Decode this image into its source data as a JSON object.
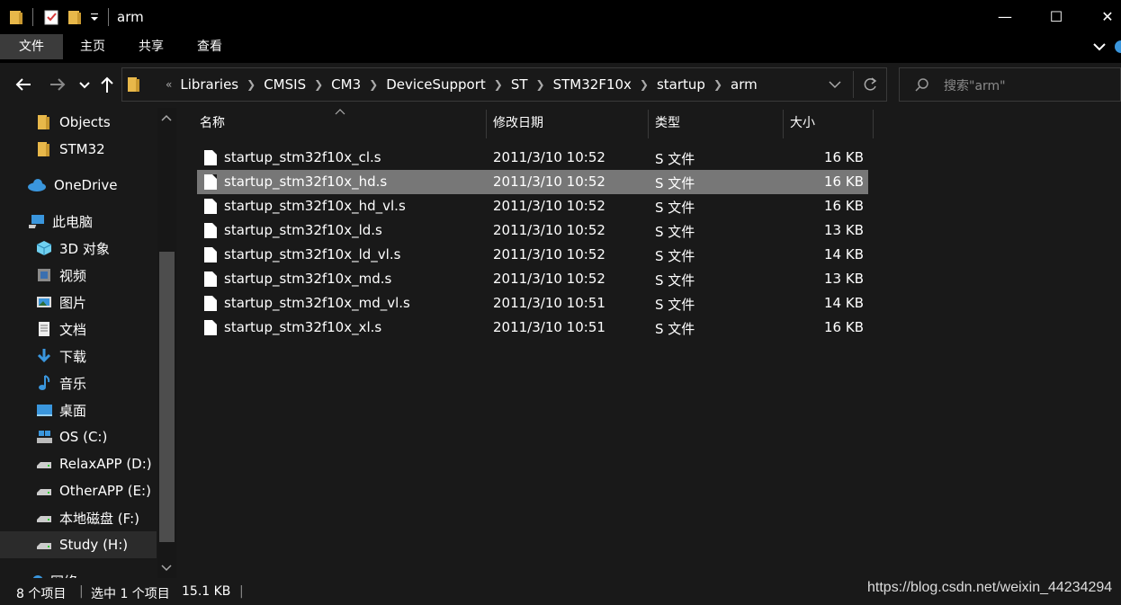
{
  "window": {
    "title": "arm",
    "minimize": "—",
    "maximize": "☐",
    "close": "✕"
  },
  "ribbon": {
    "tabs": [
      {
        "label": "文件",
        "active": true
      },
      {
        "label": "主页"
      },
      {
        "label": "共享"
      },
      {
        "label": "查看"
      }
    ]
  },
  "address": {
    "overflow": "«",
    "crumbs": [
      "Libraries",
      "CMSIS",
      "CM3",
      "DeviceSupport",
      "ST",
      "STM32F10x",
      "startup",
      "arm"
    ]
  },
  "search": {
    "placeholder": "搜索\"arm\""
  },
  "sidebar": {
    "items": [
      {
        "label": "Objects",
        "icon": "folder-icon"
      },
      {
        "label": "STM32",
        "icon": "folder-icon"
      },
      {
        "label": "OneDrive",
        "icon": "cloud-icon"
      },
      {
        "label": "此电脑",
        "icon": "pc-icon"
      },
      {
        "label": "3D 对象",
        "icon": "cube-icon"
      },
      {
        "label": "视频",
        "icon": "video-icon"
      },
      {
        "label": "图片",
        "icon": "pictures-icon"
      },
      {
        "label": "文档",
        "icon": "documents-icon"
      },
      {
        "label": "下载",
        "icon": "download-icon"
      },
      {
        "label": "音乐",
        "icon": "music-icon"
      },
      {
        "label": "桌面",
        "icon": "desktop-icon"
      },
      {
        "label": "OS (C:)",
        "icon": "os-drive-icon"
      },
      {
        "label": "RelaxAPP (D:)",
        "icon": "drive-icon"
      },
      {
        "label": "OtherAPP (E:)",
        "icon": "drive-icon"
      },
      {
        "label": "本地磁盘 (F:)",
        "icon": "drive-icon"
      },
      {
        "label": "Study (H:)",
        "icon": "drive-icon",
        "selected": true
      },
      {
        "label": "网络",
        "icon": "network-icon"
      }
    ]
  },
  "columns": {
    "name": "名称",
    "date": "修改日期",
    "type": "类型",
    "size": "大小"
  },
  "files": [
    {
      "name": "startup_stm32f10x_cl.s",
      "date": "2011/3/10 10:52",
      "type": "S 文件",
      "size": "16 KB"
    },
    {
      "name": "startup_stm32f10x_hd.s",
      "date": "2011/3/10 10:52",
      "type": "S 文件",
      "size": "16 KB",
      "selected": true
    },
    {
      "name": "startup_stm32f10x_hd_vl.s",
      "date": "2011/3/10 10:52",
      "type": "S 文件",
      "size": "16 KB"
    },
    {
      "name": "startup_stm32f10x_ld.s",
      "date": "2011/3/10 10:52",
      "type": "S 文件",
      "size": "13 KB"
    },
    {
      "name": "startup_stm32f10x_ld_vl.s",
      "date": "2011/3/10 10:52",
      "type": "S 文件",
      "size": "14 KB"
    },
    {
      "name": "startup_stm32f10x_md.s",
      "date": "2011/3/10 10:52",
      "type": "S 文件",
      "size": "13 KB"
    },
    {
      "name": "startup_stm32f10x_md_vl.s",
      "date": "2011/3/10 10:51",
      "type": "S 文件",
      "size": "14 KB"
    },
    {
      "name": "startup_stm32f10x_xl.s",
      "date": "2011/3/10 10:51",
      "type": "S 文件",
      "size": "16 KB"
    }
  ],
  "status": {
    "count": "8 个项目",
    "selection": "选中 1 个项目",
    "selected_size": "15.1 KB"
  },
  "watermark": "https://blog.csdn.net/weixin_44234294",
  "colors": {
    "background": "#191919",
    "titlebar": "#000000",
    "selection": "#777777",
    "folder": "#e8b84a",
    "accent_blue": "#3a96dd"
  }
}
